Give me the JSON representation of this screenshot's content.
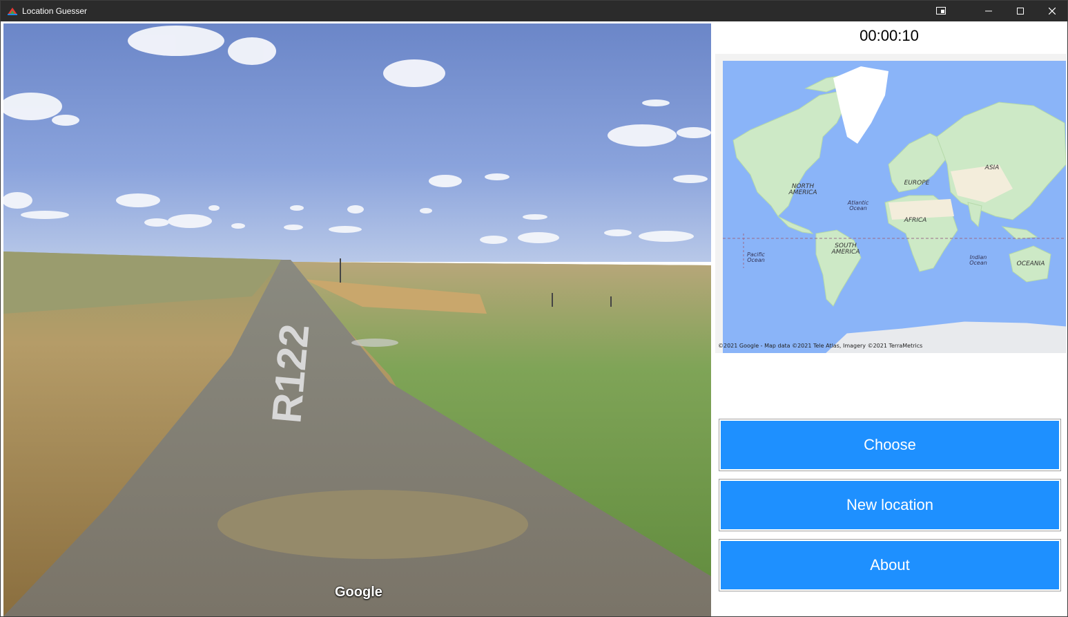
{
  "window": {
    "title": "Location Guesser"
  },
  "streetview": {
    "logo": "Google",
    "road_marking": "R122"
  },
  "timer": {
    "text": "00:00:10"
  },
  "map": {
    "labels": {
      "north_america": [
        "NORTH",
        "AMERICA"
      ],
      "south_america": [
        "SOUTH",
        "AMERICA"
      ],
      "europe": "EUROPE",
      "africa": "AFRICA",
      "asia": "ASIA",
      "oceania": "OCEANIA",
      "atlantic": [
        "Atlantic",
        "Ocean"
      ],
      "pacific": [
        "Pacific",
        "Ocean"
      ],
      "indian": [
        "Indian",
        "Ocean"
      ]
    },
    "attribution": "©2021 Google - Map data ©2021 Tele Atlas, Imagery ©2021 TerraMetrics"
  },
  "buttons": {
    "choose": "Choose",
    "new_location": "New location",
    "about": "About"
  },
  "colors": {
    "button_blue": "#1e90ff",
    "titlebar": "#2b2b2b",
    "ocean": "#8ab4f8",
    "land": "#cde9c6"
  },
  "icons": {
    "app": "app-icon",
    "snap": "snap-icon",
    "minimize": "minimize-icon",
    "maximize": "maximize-icon",
    "close": "close-icon"
  }
}
